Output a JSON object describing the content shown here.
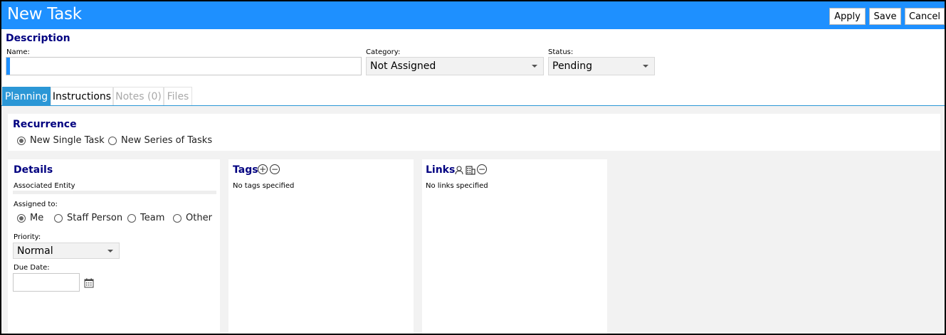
{
  "header": {
    "title": "New Task",
    "apply_label": "Apply",
    "save_label": "Save",
    "cancel_label": "Cancel"
  },
  "description": {
    "heading": "Description",
    "name_label": "Name:",
    "name_value": "",
    "category_label": "Category:",
    "category_value": "Not Assigned",
    "status_label": "Status:",
    "status_value": "Pending"
  },
  "tabs": [
    {
      "label": "Planning"
    },
    {
      "label": "Instructions"
    },
    {
      "label": "Notes (0)"
    },
    {
      "label": "Files"
    }
  ],
  "recurrence": {
    "heading": "Recurrence",
    "options": [
      "New Single Task",
      "New Series of Tasks"
    ],
    "selected": "New Single Task"
  },
  "details": {
    "heading": "Details",
    "associated_entity_label": "Associated Entity",
    "assigned_to_label": "Assigned to:",
    "assigned_options": [
      "Me",
      "Staff Person",
      "Team",
      "Other"
    ],
    "assigned_selected": "Me",
    "priority_label": "Priority:",
    "priority_value": "Normal",
    "due_date_label": "Due Date:",
    "due_date_value": ""
  },
  "tags": {
    "heading": "Tags",
    "empty_text": "No tags specified"
  },
  "links": {
    "heading": "Links",
    "empty_text": "No links specified"
  },
  "colors": {
    "titlebar": "#1e90ff",
    "heading": "#000080",
    "tab_active": "#2b97d6"
  }
}
